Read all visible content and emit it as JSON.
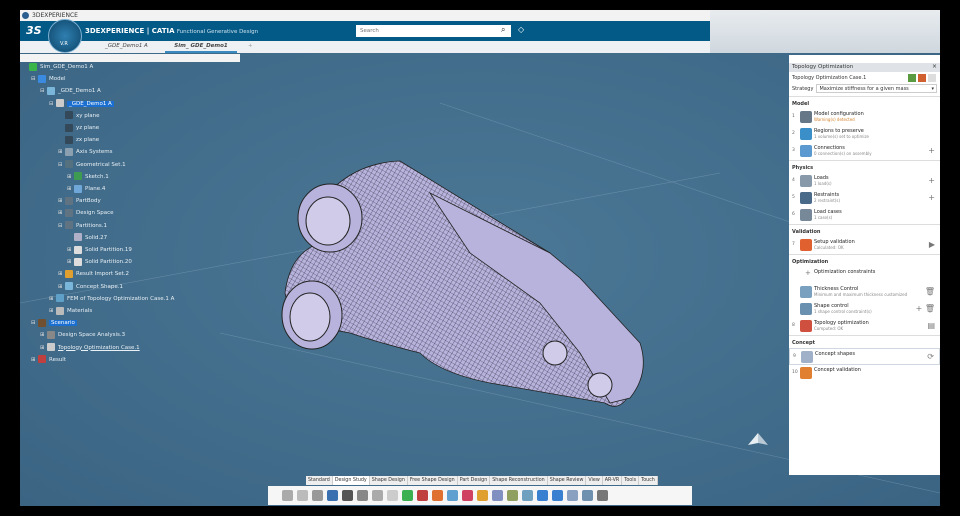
{
  "window": {
    "title": "3DEXPERIENCE"
  },
  "header": {
    "brand": "3DEXPERIENCE | CATIA",
    "app": "Functional Generative Design",
    "compass_version": "V.R",
    "search_placeholder": "Search"
  },
  "tabs": [
    {
      "label": "_GDE_Demo1 A"
    },
    {
      "label": "Sim_ GDE_Demo1",
      "active": true
    },
    {
      "label": "+"
    }
  ],
  "tree": [
    {
      "label": "Sim_GDE_Demo1 A",
      "level": 0,
      "color": "#3bb54a"
    },
    {
      "label": "Model",
      "level": 1,
      "exp": "-",
      "color": "#3a8be0"
    },
    {
      "label": "_GDE_Demo1 A",
      "level": 2,
      "exp": "-",
      "color": "#7ab6d9"
    },
    {
      "label": "_GDE_Demo1 A",
      "level": 3,
      "exp": "-",
      "color": "#cccccc",
      "selected": true
    },
    {
      "label": "xy plane",
      "level": 4,
      "color": "#33495a"
    },
    {
      "label": "yz plane",
      "level": 4,
      "color": "#33495a"
    },
    {
      "label": "zx plane",
      "level": 4,
      "color": "#33495a"
    },
    {
      "label": "Axis Systems",
      "level": 4,
      "exp": "+",
      "color": "#8aa0b0"
    },
    {
      "label": "Geometrical Set.1",
      "level": 4,
      "exp": "-",
      "color": "#55707f"
    },
    {
      "label": "Sketch.1",
      "level": 5,
      "exp": "+",
      "color": "#3d9c52"
    },
    {
      "label": "Plane.4",
      "level": 5,
      "exp": "+",
      "color": "#6fa8d8"
    },
    {
      "label": "PartBody",
      "level": 4,
      "exp": "+",
      "color": "#5f7383"
    },
    {
      "label": "Design Space",
      "level": 4,
      "exp": "+",
      "color": "#5f7383"
    },
    {
      "label": "Partitions.1",
      "level": 4,
      "exp": "-",
      "color": "#5f7383"
    },
    {
      "label": "Solid.27",
      "level": 5,
      "color": "#b0b0c8"
    },
    {
      "label": "Solid Partition.19",
      "level": 5,
      "exp": "+",
      "color": "#dddddd"
    },
    {
      "label": "Solid Partition.20",
      "level": 5,
      "exp": "+",
      "color": "#dddddd"
    },
    {
      "label": "Result Import Set.2",
      "level": 4,
      "exp": "+",
      "color": "#e0a030"
    },
    {
      "label": "Concept Shape.1",
      "level": 4,
      "exp": "+",
      "color": "#7ab6d9"
    },
    {
      "label": "FEM of Topology Optimization Case.1 A",
      "level": 3,
      "exp": "+",
      "color": "#5fa0c8"
    },
    {
      "label": "Materials",
      "level": 3,
      "exp": "+",
      "color": "#bbbbbb"
    },
    {
      "label": "Scenario",
      "level": 1,
      "exp": "-",
      "color": "#705030",
      "selected": true
    },
    {
      "label": "Design Space Analysis.3",
      "level": 2,
      "exp": "+",
      "color": "#888888"
    },
    {
      "label": "Topology Optimization Case.1",
      "level": 2,
      "exp": "+",
      "color": "#cccccc",
      "underline": true
    },
    {
      "label": "Result",
      "level": 1,
      "exp": "+",
      "color": "#c04040"
    }
  ],
  "panel": {
    "title": "Topology Optimization",
    "case": "Topology Optimization Case.1",
    "strategy_label": "Strategy",
    "strategy_value": "Maximize stiffness for a given mass",
    "sections": [
      {
        "name": "Model",
        "rows": [
          {
            "num": "1",
            "title": "Model configuration",
            "sub": "Warning(s) detected",
            "warn": true,
            "icon": "#667788"
          },
          {
            "num": "2",
            "title": "Regions to preserve",
            "sub": "1 volume(s) set to optimize",
            "icon": "#3a8fc8"
          },
          {
            "num": "3",
            "title": "Connections",
            "sub": "0 connection(s) on assembly",
            "icon": "#5a9ad0",
            "action": "+"
          }
        ]
      },
      {
        "name": "Physics",
        "rows": [
          {
            "num": "4",
            "title": "Loads",
            "sub": "1 load(s)",
            "icon": "#8899aa",
            "action": "+"
          },
          {
            "num": "5",
            "title": "Restraints",
            "sub": "2 restraint(s)",
            "icon": "#4a6a8a",
            "action": "+"
          },
          {
            "num": "6",
            "title": "Load cases",
            "sub": "1 case(s)",
            "icon": "#778899"
          }
        ]
      },
      {
        "name": "Validation",
        "rows": [
          {
            "num": "7",
            "title": "Setup validation",
            "sub": "Calculated: OK",
            "icon": "#e06030",
            "action": "▶"
          }
        ]
      },
      {
        "name": "Optimization",
        "rows": [
          {
            "num": "",
            "title": "Optimization constraints",
            "sub": "",
            "icon": "",
            "prefix": "+"
          },
          {
            "num": "",
            "title": "Thickness Control",
            "sub": "Minimum and maximum thickness customized",
            "icon": "#7aa0c0",
            "action": "🗑"
          },
          {
            "num": "",
            "title": "Shape control",
            "sub": "1 shape control constraint(s)",
            "icon": "#6a90b0",
            "action": "+ 🗑"
          },
          {
            "num": "8",
            "title": "Topology optimization",
            "sub": "Computed: OK",
            "icon": "#d05040",
            "action": "▤"
          }
        ]
      },
      {
        "name": "Concept",
        "rows": [
          {
            "num": "9",
            "title": "Concept shapes",
            "sub": "",
            "icon": "#a0b0c8",
            "action": "⟳"
          },
          {
            "num": "10",
            "title": "Concept validation",
            "sub": "",
            "icon": "#e08030"
          }
        ]
      }
    ]
  },
  "toolbar": {
    "tabs": [
      "Standard",
      "Design Study",
      "Shape Design",
      "Free Shape Design",
      "Part Design",
      "Shape Reconstruction",
      "Shape Review",
      "View",
      "AR-VR",
      "Tools",
      "Touch"
    ],
    "active_tab": "Design Study"
  },
  "colors": {
    "header": "#045a87",
    "viewport": "#436e8e",
    "model": "#b8b3dc",
    "selection": "#1a6fd1"
  }
}
